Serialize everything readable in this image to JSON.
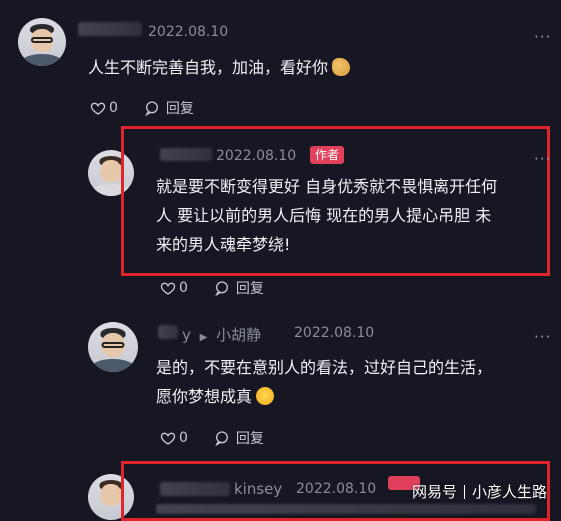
{
  "comments": [
    {
      "date": "2022.08.10",
      "text": "人生不断完善自我，加油，看好你",
      "likes": "0",
      "reply_label": "回复"
    },
    {
      "date": "2022.08.10",
      "badge": "作者",
      "text_lines": [
        "就是要不断变得更好 自身优秀就不畏惧离开任何",
        "人 要让以前的男人后悔 现在的男人提心吊胆 未",
        "来的男人魂牵梦绕!"
      ],
      "likes": "0",
      "reply_label": "回复"
    },
    {
      "user_suffix": "y",
      "reply_to": "小胡静",
      "date": "2022.08.10",
      "text_lines": [
        "是的，不要在意别人的看法，过好自己的生活，",
        "愿你梦想成真"
      ],
      "likes": "0",
      "reply_label": "回复"
    },
    {
      "reply_to": "kinsey",
      "date": "2022.08.10"
    }
  ],
  "more_label": "···",
  "watermark": {
    "brand": "网易号",
    "author": "小彦人生路"
  },
  "colors": {
    "background": "#161722",
    "highlight_box": "#e0242b",
    "author_badge": "#e1405c"
  },
  "icons": [
    "heart-icon",
    "reply-icon",
    "more-icon",
    "avatar",
    "flexed-arm-emoji",
    "grin-emoji"
  ]
}
